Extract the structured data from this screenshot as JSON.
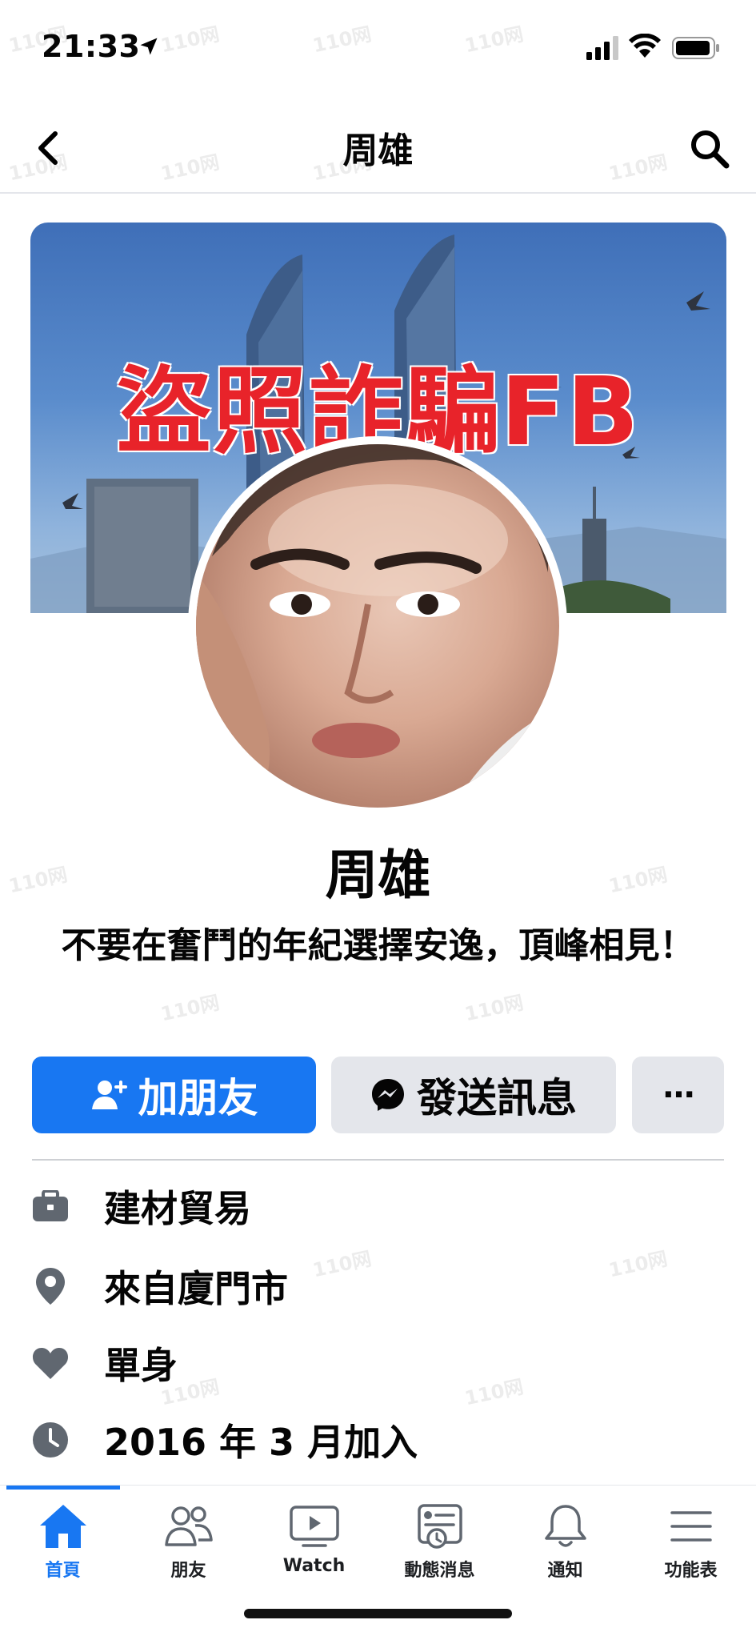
{
  "status_bar": {
    "time": "21:33"
  },
  "header": {
    "title": "周雄"
  },
  "cover": {
    "overlay_text": "盜照詐騙FB"
  },
  "profile": {
    "name": "周雄",
    "bio": "不要在奮鬥的年紀選擇安逸，頂峰相見！"
  },
  "actions": {
    "add_friend_label": "加朋友",
    "message_label": "發送訊息",
    "more_label": "···"
  },
  "info": [
    {
      "icon": "briefcase-icon",
      "text": "建材貿易"
    },
    {
      "icon": "location-pin-icon",
      "text": "來自廈門市"
    },
    {
      "icon": "heart-icon",
      "text": "單身"
    },
    {
      "icon": "clock-icon",
      "text": "2016 年 3 月加入"
    }
  ],
  "tabs": [
    {
      "icon": "home-icon",
      "label": "首頁",
      "active": true
    },
    {
      "icon": "friends-icon",
      "label": "朋友"
    },
    {
      "icon": "watch-icon",
      "label": "Watch"
    },
    {
      "icon": "news-feed-icon",
      "label": "動態消息"
    },
    {
      "icon": "bell-icon",
      "label": "通知"
    },
    {
      "icon": "menu-icon",
      "label": "功能表"
    }
  ],
  "watermark": "110网",
  "colors": {
    "primary": "#1877f2",
    "secondary_button": "#e4e6eb",
    "overlay_red": "#e8232a"
  }
}
